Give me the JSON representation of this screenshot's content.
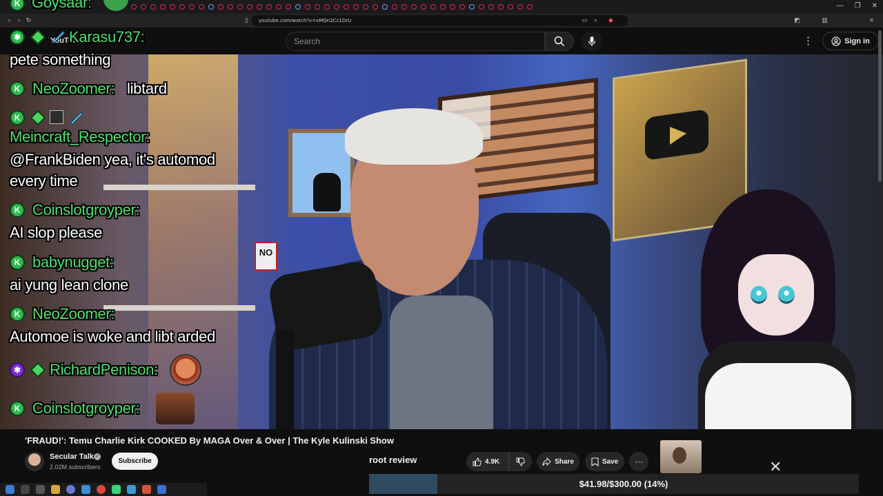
{
  "browser": {
    "url": "youtube.com/watch?v=xMQn2Cc1DrU",
    "window_controls": [
      "—",
      "❐",
      "✕"
    ]
  },
  "header": {
    "logo": "YouTube",
    "search_placeholder": "Search",
    "sign_in_label": "Sign in"
  },
  "chat": {
    "lines": [
      {
        "user": "Goysaar:",
        "message": ""
      },
      {
        "user": "Karasu737:",
        "message": ""
      },
      {
        "user": "",
        "message": "pete something"
      },
      {
        "user": "NeoZoomer:",
        "message": "libtard"
      },
      {
        "user": "Meincraft_Respector:",
        "message": ""
      },
      {
        "user": "",
        "message": "@FrankBiden yea, it's automod"
      },
      {
        "user": "",
        "message": "every time"
      },
      {
        "user": "Coinslotgroyper:",
        "message": ""
      },
      {
        "user": "",
        "message": "AI slop please"
      },
      {
        "user": "babynugget:",
        "message": ""
      },
      {
        "user": "",
        "message": "ai yung lean clone"
      },
      {
        "user": "NeoZoomer:",
        "message": ""
      },
      {
        "user": "",
        "message": "Automoe is woke and libt arded"
      },
      {
        "user": "RichardPenison:",
        "message": ""
      },
      {
        "user": "Coinslotgroyper:",
        "message": ""
      }
    ]
  },
  "scene": {
    "no_sign": "NO"
  },
  "video": {
    "title": "'FRAUD!': Temu Charlie Kirk COOKED By MAGA Over & Over | The Kyle Kulinski Show",
    "channel_name": "Secular Talk",
    "subscribers": "2.02M subscribers",
    "subscribe_label": "Subscribe",
    "like_count": "4.9K",
    "share_label": "Share",
    "save_label": "Save",
    "more_label": "···"
  },
  "overlay": {
    "root_review": "root review",
    "donation_goal_text": "$41.98/$300.00 (14%)",
    "donation_goal_progress": 0.14
  },
  "colors": {
    "chat_user": "#4ee26b",
    "chat_message": "#ffffff",
    "page_bg": "#0f0f0f"
  }
}
